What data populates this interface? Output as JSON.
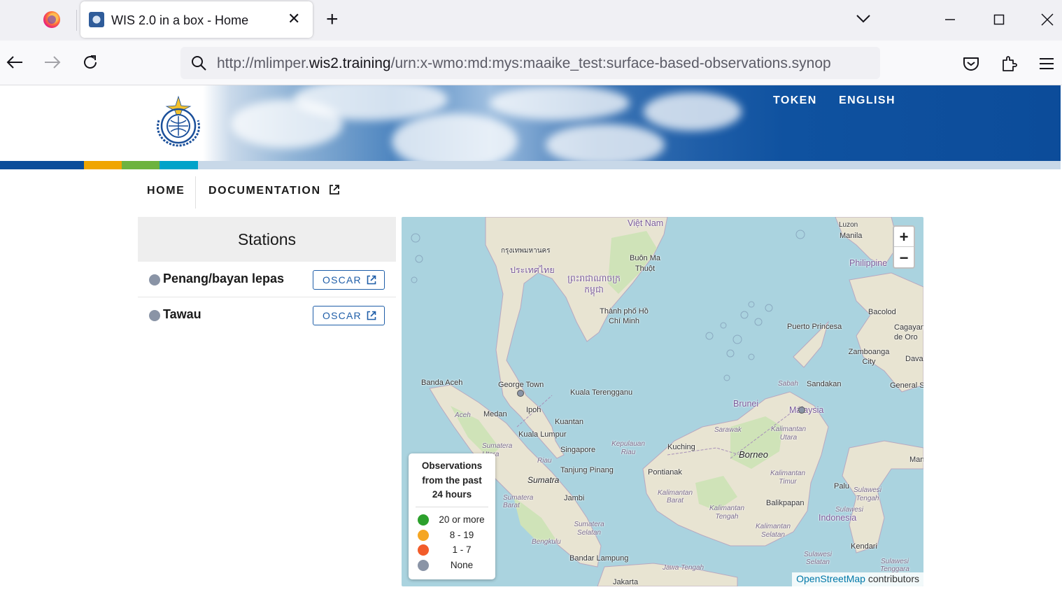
{
  "browser": {
    "tab_title": "WIS 2.0 in a box - Home",
    "close_glyph": "✕",
    "new_tab_glyph": "+",
    "list_tabs_glyph": "⌄",
    "minimize_glyph": "—",
    "maximize_glyph": "☐",
    "close_window_glyph": "✕",
    "back_glyph": "←",
    "forward_glyph": "→",
    "reload_glyph": "↻",
    "menu_glyph": "☰",
    "url_prefix": "http://mlimper.",
    "url_domain": "wis2.training",
    "url_path": "/urn:x-wmo:md:mys:maaike_test:surface-based-observations.synop"
  },
  "header": {
    "links": [
      "TOKEN",
      "ENGLISH"
    ],
    "strip_colors": [
      "#0b4d9a",
      "#f0a500",
      "#6db33f",
      "#00a3c9",
      "#c8d8e8"
    ]
  },
  "subnav": {
    "home": "HOME",
    "documentation": "DOCUMENTATION"
  },
  "stations": {
    "heading": "Stations",
    "button_label": "OSCAR",
    "items": [
      {
        "name": "Penang/bayan lepas"
      },
      {
        "name": "Tawau"
      }
    ]
  },
  "map": {
    "zoom_in": "+",
    "zoom_out": "−",
    "labels": {
      "vietnam": "Việt Nam",
      "luzon": "Luzon",
      "manila": "Manila",
      "philippines": "Philippine",
      "bangkok": "กรุงเทพมหานคร",
      "thailand": "ประเทศไทย",
      "cambodia": "ព្រះរាជាណាចក្រ កម្ពុជា",
      "buon_ma_thuot": "Buôn Ma Thuột",
      "hcmc": "Thành phố Hồ Chí Minh",
      "bacolod": "Bacolod",
      "puerto_princesa": "Puerto Princesa",
      "cagayan": "Cagayan de Oro",
      "zamboanga": "Zamboanga City",
      "davao": "Dava",
      "banda_aceh": "Banda Aceh",
      "george_town": "George Town",
      "kuala_terengganu": "Kuala Terengganu",
      "sabah": "Sabah",
      "sandakan": "Sandakan",
      "general_santos": "General S",
      "aceh": "Aceh",
      "medan": "Medan",
      "ipoh": "Ipoh",
      "brunei": "Brunei",
      "malaysia": "Malaysia",
      "kuantan": "Kuantan",
      "sarawak": "Sarawak",
      "kalimantan_utara": "Kalimantan Utara",
      "kuala_lumpur": "Kuala Lumpur",
      "sumatera_utara": "Sumatera Utara",
      "singapore": "Singapore",
      "kepulauan_riau": "Kepulauan Riau",
      "kuching": "Kuching",
      "borneo": "Borneo",
      "manado": "Manad",
      "riau": "Riau",
      "tanjung_pinang": "Tanjung Pinang",
      "pontianak": "Pontianak",
      "sumatra": "Sumatra",
      "kalimantan_timur": "Kalimantan Timur",
      "palu": "Palu",
      "sumatera_barat": "Sumatera Barat",
      "jambi": "Jambi",
      "kalimantan_barat": "Kalimantan Barat",
      "sulawesi_tengah": "Sulawesi Tengah",
      "balikpapan": "Balikpapan",
      "kalimantan_tengah": "Kalimantan Tengah",
      "sulawesi": "Sulawesi",
      "indonesia": "Indonesia",
      "sumatera_selatan": "Sumatera Selatan",
      "kalimantan_selatan": "Kalimantan Selatan",
      "bengkulu": "Bengkulu",
      "kendari": "Kendari",
      "bandar_lampung": "Bandar Lampung",
      "jawa_tengah": "Jawa Tengah",
      "sulawesi_selatan": "Sulawesi Selatan",
      "sulawesi_tenggara": "Sulawesi Tenggara",
      "jakarta": "Jakarta"
    },
    "legend": {
      "title_line1": "Observations",
      "title_line2": "from the past",
      "title_line3": "24 hours",
      "items": [
        {
          "label": "20 or more",
          "color": "#2ca02c"
        },
        {
          "label": "8 - 19",
          "color": "#f5a623"
        },
        {
          "label": "1 - 7",
          "color": "#f25c2a"
        },
        {
          "label": "None",
          "color": "#8a94a6"
        }
      ]
    },
    "attribution_link": "OpenStreetMap",
    "attribution_text": " contributors"
  }
}
